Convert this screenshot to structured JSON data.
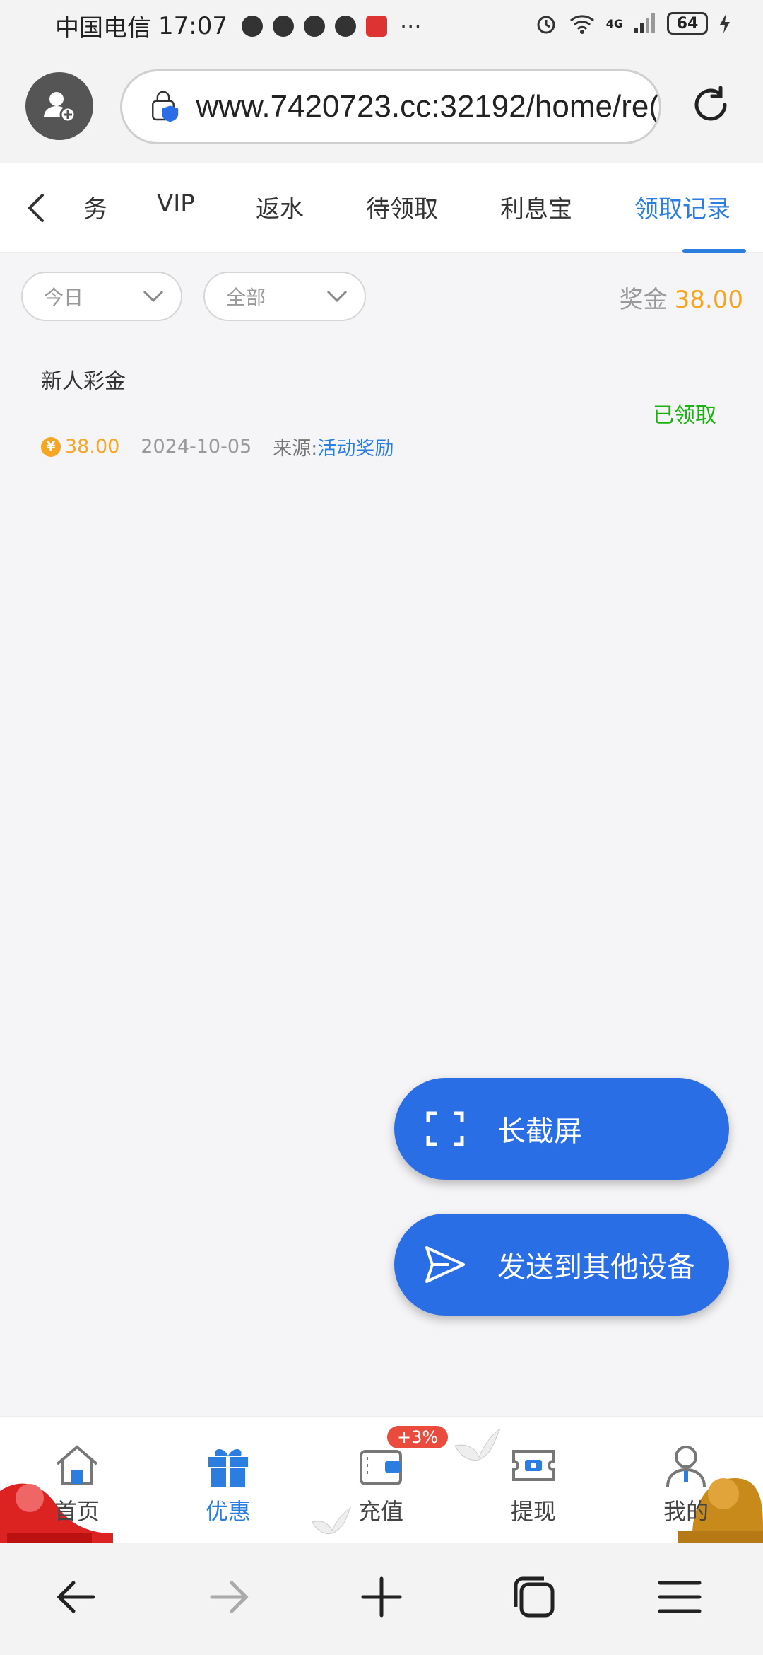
{
  "status_bar": {
    "carrier": "中国电信",
    "time": "17:07",
    "network": "4G",
    "battery": "64"
  },
  "browser": {
    "url": "www.7420723.cc:32192/home/re("
  },
  "tabs": [
    {
      "label": "务",
      "active": false
    },
    {
      "label": "VIP",
      "active": false
    },
    {
      "label": "返水",
      "active": false
    },
    {
      "label": "待领取",
      "active": false
    },
    {
      "label": "利息宝",
      "active": false
    },
    {
      "label": "领取记录",
      "active": true
    }
  ],
  "filters": {
    "date": "今日",
    "type": "全部"
  },
  "bonus": {
    "label": "奖金",
    "amount": "38.00"
  },
  "record": {
    "title": "新人彩金",
    "status": "已领取",
    "coin_symbol": "¥",
    "amount": "38.00",
    "date": "2024-10-05",
    "source_label": "来源:",
    "source": "活动奖励"
  },
  "floating": {
    "long_screenshot": "长截屏",
    "send_to_device": "发送到其他设备"
  },
  "app_nav": {
    "items": [
      {
        "label": "首页",
        "icon": "home-icon"
      },
      {
        "label": "优惠",
        "icon": "gift-icon"
      },
      {
        "label": "充值",
        "icon": "wallet-icon"
      },
      {
        "label": "提现",
        "icon": "withdraw-icon"
      },
      {
        "label": "我的",
        "icon": "profile-icon"
      }
    ],
    "recharge_badge": "+3%"
  },
  "colors": {
    "accent_blue": "#2b7de0",
    "fab_blue": "#2a6ee6",
    "gold": "#f5a623",
    "green": "#19b30e",
    "badge_red": "#e94b3c"
  }
}
